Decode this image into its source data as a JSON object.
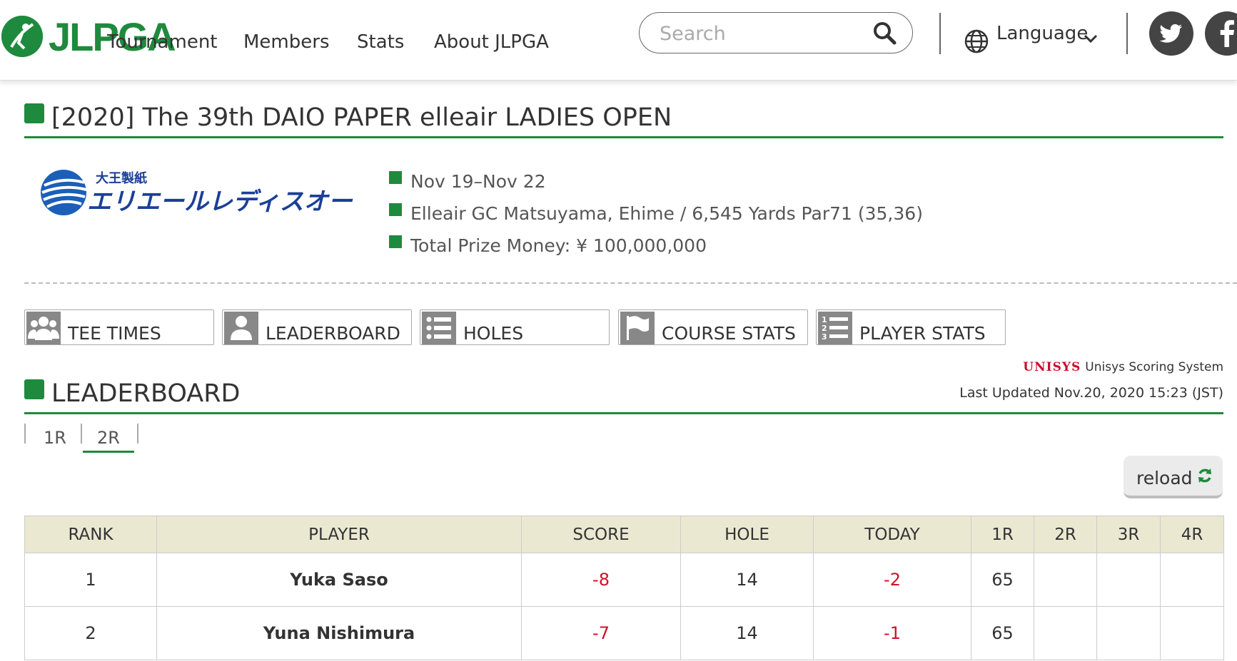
{
  "header": {
    "logo_text": "JLPGA",
    "nav": [
      "Tournament",
      "Members",
      "Stats",
      "About JLPGA"
    ],
    "search_placeholder": "Search",
    "language_label": "Language"
  },
  "tournament": {
    "title": "[2020] The 39th DAIO PAPER elleair LADIES OPEN",
    "sponsor_logo_small": "大王製紙",
    "sponsor_logo_main": "エリエールレディスオープン",
    "dates": "Nov 19–Nov 22",
    "venue": "Elleair GC Matsuyama, Ehime / 6,545 Yards Par71 (35,36)",
    "prize": "Total Prize Money: ¥ 100,000,000"
  },
  "tabs": [
    "TEE TIMES",
    "LEADERBOARD",
    "HOLES",
    "COURSE STATS",
    "PLAYER STATS"
  ],
  "leaderboard": {
    "title": "LEADERBOARD",
    "scoring_logo": "UNISYS",
    "scoring_system": "Unisys Scoring System",
    "last_updated": "Last Updated Nov.20, 2020 15:23 (JST)",
    "rounds": [
      "1R",
      "2R"
    ],
    "active_round": "2R",
    "reload_label": "reload",
    "columns": [
      "RANK",
      "PLAYER",
      "SCORE",
      "HOLE",
      "TODAY",
      "1R",
      "2R",
      "3R",
      "4R"
    ],
    "rows": [
      {
        "rank": "1",
        "player": "Yuka Saso",
        "score": "-8",
        "hole": "14",
        "today": "-2",
        "r1": "65",
        "r2": "",
        "r3": "",
        "r4": ""
      },
      {
        "rank": "2",
        "player": "Yuna Nishimura",
        "score": "-7",
        "hole": "14",
        "today": "-1",
        "r1": "65",
        "r2": "",
        "r3": "",
        "r4": ""
      }
    ]
  },
  "colors": {
    "accent_green": "#1e8a3d",
    "table_header_bg": "#ebe8d2",
    "negative_score": "#d0102a",
    "tab_icon_bg": "#888888"
  }
}
